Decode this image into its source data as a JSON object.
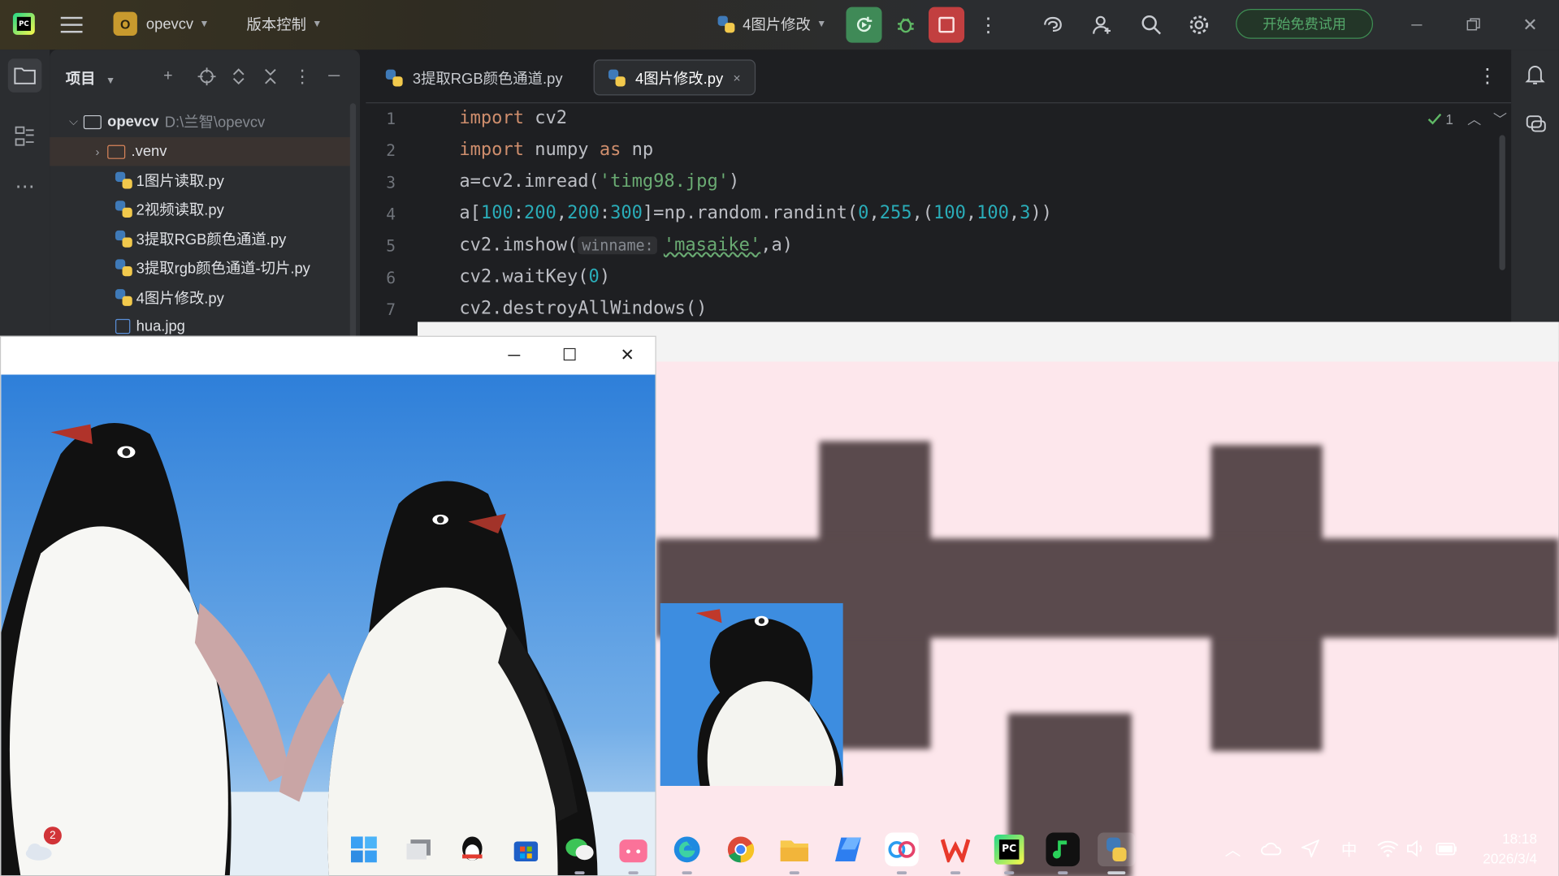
{
  "titlebar": {
    "project_badge": "O",
    "project_name": "opevcv",
    "vcs_label": "版本控制",
    "run_config": "4图片修改",
    "trial_button": "开始免费试用"
  },
  "project_panel": {
    "title": "项目",
    "root_name": "opevcv",
    "root_path": "D:\\兰智\\opevcv",
    "items": [
      {
        "label": ".venv",
        "type": "folder"
      },
      {
        "label": "1图片读取.py",
        "type": "py"
      },
      {
        "label": "2视频读取.py",
        "type": "py"
      },
      {
        "label": "3提取RGB颜色通道.py",
        "type": "py"
      },
      {
        "label": "3提取rgb颜色通道-切片.py",
        "type": "py"
      },
      {
        "label": "4图片修改.py",
        "type": "py"
      },
      {
        "label": "hua.jpg",
        "type": "image"
      }
    ]
  },
  "editor": {
    "tabs": [
      {
        "label": "3提取RGB颜色通道.py",
        "active": false
      },
      {
        "label": "4图片修改.py",
        "active": true,
        "close": "×"
      }
    ],
    "line_numbers": [
      "1",
      "2",
      "3",
      "4",
      "5",
      "6",
      "7"
    ],
    "inspection_count": "1",
    "code": {
      "l1_kw": "import",
      "l1_rest": " cv2",
      "l2_kw1": "import",
      "l2_mid": " numpy ",
      "l2_kw2": "as",
      "l2_end": " np",
      "l3_a": "a=cv2.imread(",
      "l3_str": "'timg98.jpg'",
      "l3_b": ")",
      "l4_a": "a[",
      "l4_n1": "100",
      "l4_c1": ":",
      "l4_n2": "200",
      "l4_c2": ",",
      "l4_n3": "200",
      "l4_c3": ":",
      "l4_n4": "300",
      "l4_b": "]=np.random.randint(",
      "l4_n5": "0",
      "l4_c4": ",",
      "l4_n6": "255",
      "l4_c5": ",(",
      "l4_n7": "100",
      "l4_c6": ",",
      "l4_n8": "100",
      "l4_c7": ",",
      "l4_n9": "3",
      "l4_end": "))",
      "l5_a": "cv2.imshow(",
      "l5_hint": "winname:",
      "l5_str": "'masaike'",
      "l5_b": ",a)",
      "l6_a": "cv2.waitKey(",
      "l6_n": "0",
      "l6_b": ")",
      "l7": "cv2.destroyAllWindows()"
    }
  },
  "imshow_window": {
    "minimize": "─",
    "maximize": "☐",
    "close": "✕"
  },
  "taskbar": {
    "weather_badge": "2",
    "apps": [
      "start-icon",
      "task-view-icon",
      "qq-icon",
      "store-icon",
      "wechat-icon",
      "bilibili-icon",
      "edge-icon",
      "chrome-icon",
      "file-explorer-icon",
      "blue-app-icon",
      "baidu-netdisk-icon",
      "wps-icon",
      "pycharm-icon",
      "music-icon",
      "python-icon"
    ],
    "ime": "中",
    "time": "18:18",
    "date": "2026/3/4"
  },
  "colors": {
    "ide_bg": "#1e1f22",
    "panel_bg": "#2b2d30",
    "keyword": "#cf8e6d",
    "string": "#6aab73",
    "number": "#2aacb8",
    "run_green": "#3f8a57",
    "stop_red": "#c23f40"
  }
}
